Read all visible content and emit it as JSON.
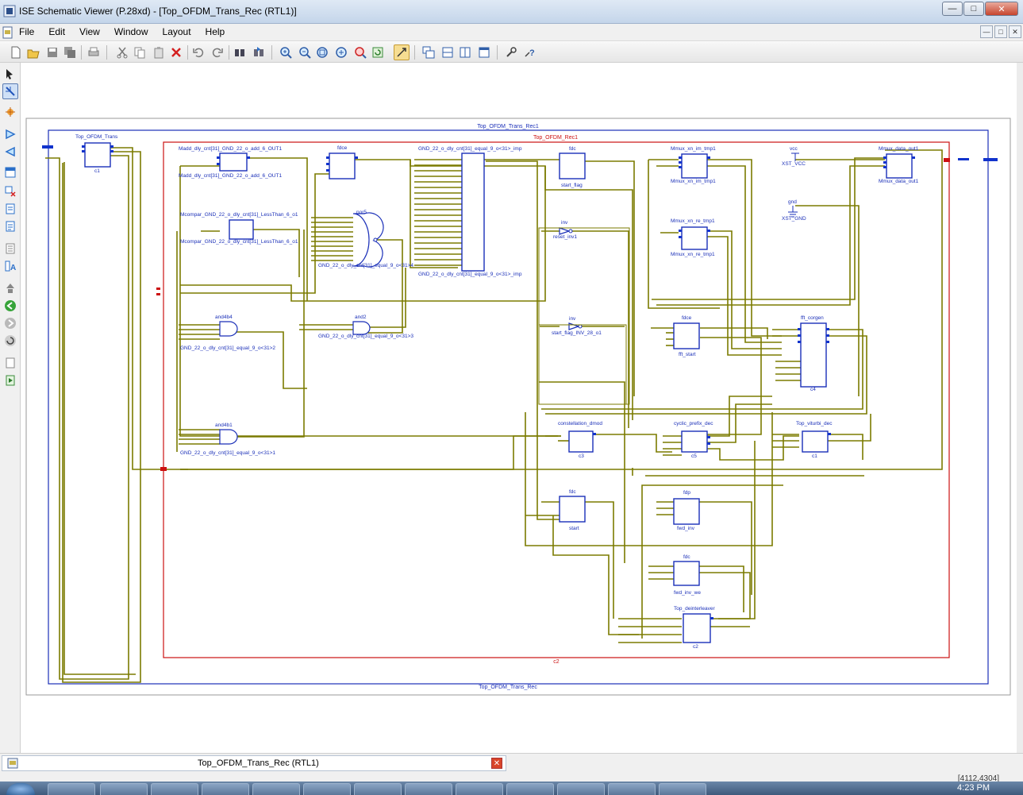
{
  "window": {
    "title": "ISE Schematic Viewer (P.28xd) - [Top_OFDM_Trans_Rec (RTL1)]"
  },
  "menu": [
    "File",
    "Edit",
    "View",
    "Window",
    "Layout",
    "Help"
  ],
  "toolbar": {
    "icons": [
      "new-icon",
      "open-icon",
      "save-icon",
      "save-all-icon",
      "print-icon",
      "cut-icon",
      "copy-icon",
      "paste-icon",
      "delete-icon",
      "undo-icon",
      "redo-icon",
      "find-icon",
      "find-next-icon",
      "zoom-in-icon",
      "zoom-out-icon",
      "zoom-full-icon",
      "zoom-area-icon",
      "zoom-to-selected-icon",
      "refresh-icon",
      "pan-icon",
      "cascade-icon",
      "tile-horizontal-icon",
      "tile-vertical-icon",
      "window-icon",
      "properties-icon",
      "help-icon"
    ]
  },
  "schematic": {
    "outer_name": "Top_OFDM_Trans_Rec1",
    "outer_footer": "Top_OFDM_Trans_Rec",
    "inner_name": "Top_OFDM_Rec1",
    "inner_footer": "c2",
    "blocks": {
      "trans_top": "Top_OFDM_Trans",
      "trans_inst": "c1",
      "madd_top": "Madd_dly_cnt[31]_GND_22_o_add_6_OUT1",
      "madd_bot": "Madd_dly_cnt[31]_GND_22_o_add_6_OUT1",
      "fdce1": "fdce",
      "gnd_eq_top": "GND_22_o_dly_cnt[31]_equal_9_o<31>_imp",
      "gnd_eq_bot": "GND_22_o_dly_cnt[31]_equal_9_o<31>_imp",
      "fdc_start_flag_type": "fdc",
      "fdc_start_flag": "start_flag",
      "mmux_im_top": "Mmux_xn_im_tmp1",
      "mmux_im_bot": "Mmux_xn_im_tmp1",
      "vcc_type": "vcc",
      "vcc": "XST_VCC",
      "mmux_out_top": "Mmux_data_out1",
      "mmux_out_bot": "Mmux_data_out1",
      "mcompar_top": "Mcompar_GND_22_o_dly_cnt[31]_LessThan_6_o1",
      "mcompar_bot": "Mcompar_GND_22_o_dly_cnt[31]_LessThan_6_o1",
      "nor5_type": "nor5",
      "nor5": "GND_22_o_dly_cnt[31]_equal_9_o<31>4",
      "inv1_type": "inv",
      "inv1": "reset_inv1",
      "mmux_re_top": "Mmux_xn_re_tmp1",
      "mmux_re_bot": "Mmux_xn_re_tmp1",
      "gnd_type": "gnd",
      "gnd": "XST_GND",
      "and4b4_type": "and4b4",
      "and4b4": "GND_22_o_dly_cnt[31]_equal_9_o<31>2",
      "and2_type": "and2",
      "and2": "GND_22_o_dly_cnt[31]_equal_9_o<31>3",
      "inv2_type": "inv",
      "inv2": "start_flag_INV_28_o1",
      "fdce2_type": "fdce",
      "fdce2": "fft_start",
      "fft_top": "fft_corgen",
      "fft_inst": "c4",
      "and4b1_type": "and4b1",
      "and4b1": "GND_22_o_dly_cnt[31]_equal_9_o<31>1",
      "const_top": "constellation_dmod",
      "const_inst": "c3",
      "cp_top": "cyclic_prefix_dec",
      "cp_inst": "c5",
      "vit_top": "Top_viturbi_dec",
      "vit_inst": "c1",
      "fdc_start_type": "fdc",
      "fdc_start": "start",
      "fdp_type": "fdp",
      "fdp": "fwd_inv",
      "fdc_we_type": "fdc",
      "fdc_we": "fwd_inv_we",
      "deint_top": "Top_deinterleaver",
      "deint_inst": "c2"
    }
  },
  "tab": {
    "label": "Top_OFDM_Trans_Rec (RTL1)"
  },
  "status": {
    "coords": "[4112,4304]"
  },
  "taskbar": {
    "clock": "4:23 PM"
  },
  "colors": {
    "wire": "#7b7b00",
    "block": "#1a2fb8",
    "inner_border": "#cc1111",
    "pin": "#1133cc"
  }
}
